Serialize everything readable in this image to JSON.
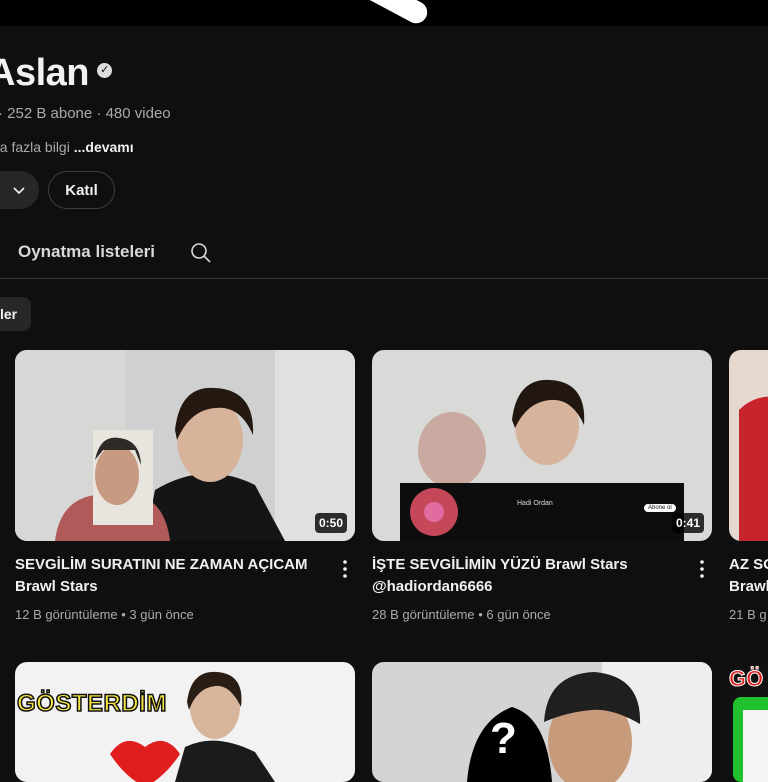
{
  "channel": {
    "name": "Aslan",
    "stats": "· 252 B abone · 480 video",
    "desc_prefix": "ha fazla bilgi",
    "desc_more": "...devamı",
    "join_label": "Katıl"
  },
  "tabs": {
    "playlists_label": "Oynatma listeleri"
  },
  "chips": {
    "partial_label": "ler"
  },
  "videos": [
    {
      "title_line1": "SEVGİLİM SURATINI NE ZAMAN AÇICAM",
      "title_line2": "Brawl Stars",
      "duration": "0:50",
      "views": "12 B görüntüleme",
      "age": "3 gün önce"
    },
    {
      "title_line1": "İŞTE SEVGİLİMİN YÜZÜ Brawl Stars",
      "title_line2": "@hadiordan6666",
      "duration": "0:41",
      "views": "28 B görüntüleme",
      "age": "6 gün önce",
      "overlay_name": "Hadi Ordan",
      "overlay_btn": "Abone ol"
    },
    {
      "title_line1": "AZ SO",
      "title_line2": "Brawl",
      "views": "21 B g"
    }
  ],
  "row2": {
    "thumb1_text": "GÖSTERDİM",
    "thumb2_text": "?",
    "thumb3_text": "GÖ"
  },
  "colors": {
    "background": "#0f0f0f",
    "text_primary": "#f1f1f1",
    "text_secondary": "#aaaaaa",
    "chip_bg": "#272727"
  }
}
